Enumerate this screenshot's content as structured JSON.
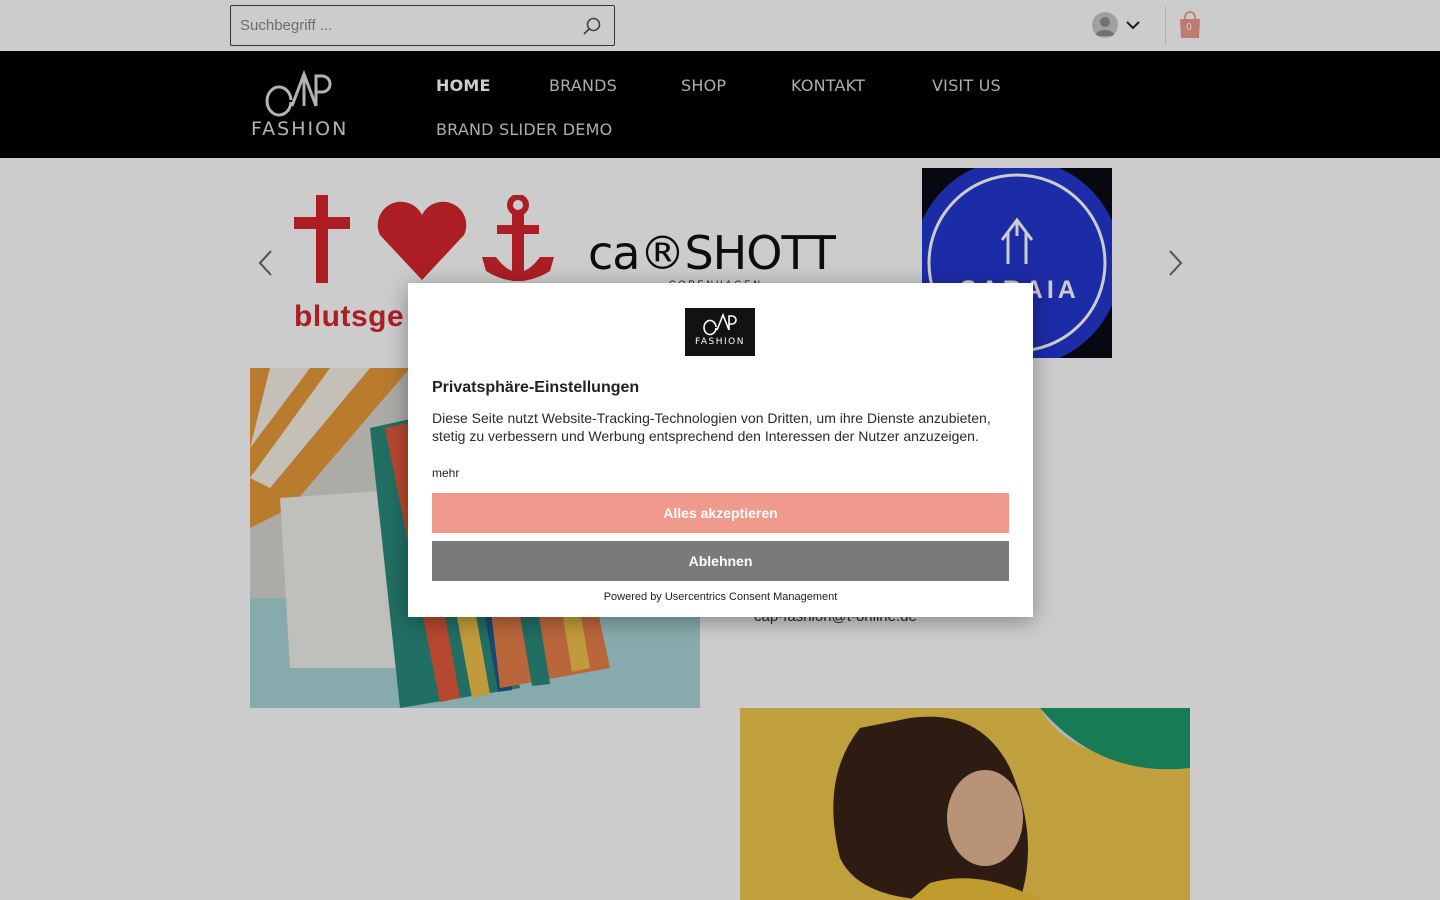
{
  "search": {
    "placeholder": "Suchbegriff ..."
  },
  "cart": {
    "count": "0"
  },
  "logo": {
    "line1": "CAP",
    "line2": "FASHION"
  },
  "nav": {
    "items": [
      {
        "label": "HOME"
      },
      {
        "label": "BRANDS"
      },
      {
        "label": "SHOP"
      },
      {
        "label": "KONTAKT"
      },
      {
        "label": "VISIT US"
      },
      {
        "label": "BRAND SLIDER DEMO"
      }
    ]
  },
  "slider": {
    "brands": [
      {
        "text": "blutsge"
      },
      {
        "text": "ca®SHOTT",
        "sub": "COPENHAGEN"
      },
      {
        "text": "SARAIA"
      }
    ]
  },
  "contact": {
    "email": "cap-fashion@t-online.de"
  },
  "consent": {
    "logo_line1": "CAP",
    "logo_line2": "FASHION",
    "title": "Privatsphäre-Einstellungen",
    "text": "Diese Seite nutzt Website-Tracking-Technologien von Dritten, um ihre Dienste anzubieten, stetig zu verbessern und Werbung entsprechend den Interessen der Nutzer anzuzeigen.",
    "more": "mehr",
    "accept": "Alles akzeptieren",
    "deny": "Ablehnen",
    "powered": "Powered by Usercentrics Consent Management"
  },
  "colors": {
    "accept_button": "#f09a8e",
    "deny_button": "#7a7a7a",
    "nav_background": "#000000",
    "brand_red": "#d8262e"
  }
}
